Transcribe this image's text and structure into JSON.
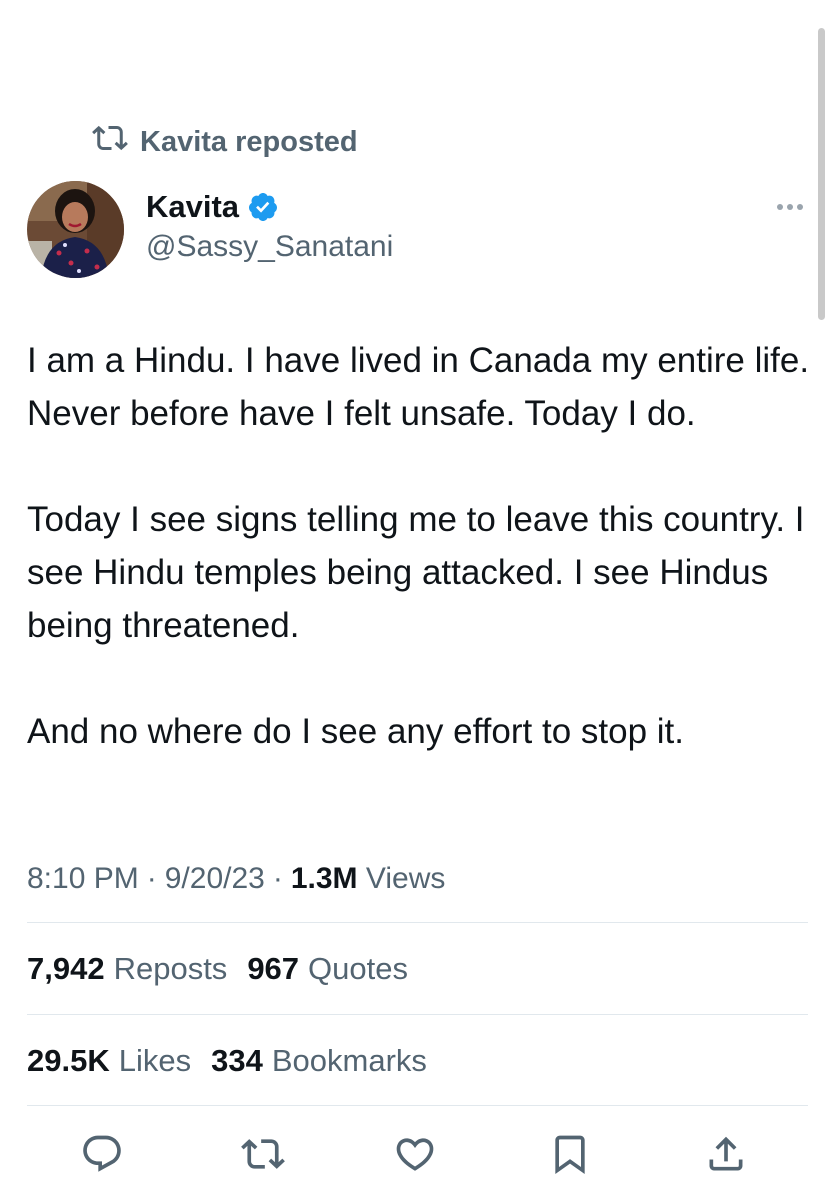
{
  "repost_banner": {
    "text": "Kavita reposted",
    "icon": "repost-icon"
  },
  "author": {
    "name": "Kavita",
    "handle": "@Sassy_Sanatani",
    "verified": true,
    "verified_color": "#1d9bf0"
  },
  "tweet": {
    "paragraphs": [
      "I am a Hindu. I have lived in Canada my entire life. Never before have I felt unsafe. Today I do.",
      "Today I see signs telling me to leave this country. I see Hindu temples being attacked. I see Hindus being threatened.",
      "And no where do I see any effort to stop it."
    ],
    "time": "8:10 PM",
    "separator": "·",
    "date": "9/20/23",
    "views_count": "1.3M",
    "views_label": "Views"
  },
  "stats": {
    "reposts_count": "7,942",
    "reposts_label": "Reposts",
    "quotes_count": "967",
    "quotes_label": "Quotes",
    "likes_count": "29.5K",
    "likes_label": "Likes",
    "bookmarks_count": "334",
    "bookmarks_label": "Bookmarks"
  },
  "actions": [
    "reply-icon",
    "repost-icon",
    "like-icon",
    "bookmark-icon",
    "share-icon"
  ],
  "colors": {
    "text_primary": "#0f1419",
    "text_secondary": "#536471",
    "icon": "#536471",
    "divider": "#e1e8ed"
  }
}
